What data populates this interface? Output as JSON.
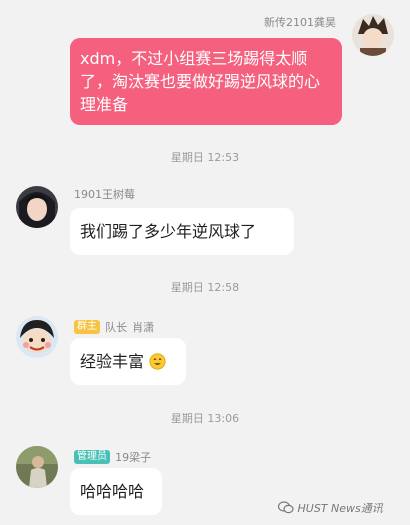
{
  "messages": {
    "m1": {
      "sender": "新传2101龚昊",
      "text": "xdm，不过小组赛三场踢得太顺了，淘汰赛也要做好踢逆风球的心理准备"
    },
    "t1": "星期日 12:53",
    "m2": {
      "sender": "1901王树莓",
      "text": "我们踢了多少年逆风球了"
    },
    "t2": "星期日 12:58",
    "m3": {
      "badge": "群主",
      "role": "队长",
      "sender": "肖潇",
      "text": "经验丰富"
    },
    "t3": "星期日 13:06",
    "m4": {
      "badge": "管理员",
      "sender": "19梁子",
      "text": "哈哈哈哈"
    }
  },
  "watermark": "HUST News通讯",
  "colors": {
    "my_bubble": "#f4607e",
    "owner_badge": "#f6c342",
    "admin_badge": "#49c0b6"
  },
  "icons": {
    "m3_emoji": "grinning-face-icon"
  }
}
